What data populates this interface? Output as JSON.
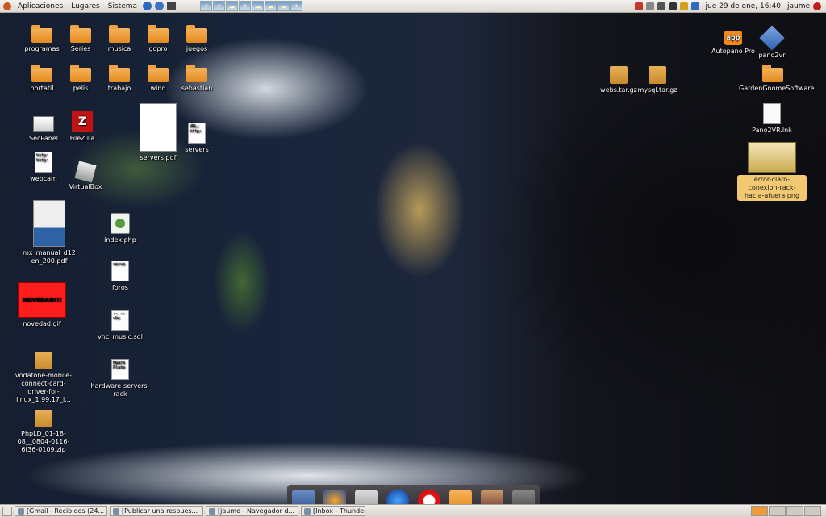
{
  "panel": {
    "menus": [
      "Aplicaciones",
      "Lugares",
      "Sistema"
    ],
    "clock": "jue 29 de ene, 16:40",
    "user": "jaume"
  },
  "desktop_icons": {
    "programas": "programas",
    "series": "Series",
    "musica": "musica",
    "gopro": "gopro",
    "juegos": "juegos",
    "portatil": "portatil",
    "pelis": "pelis",
    "trabajo": "trabajo",
    "wind": "wind",
    "sebastian": "sebastian",
    "secpanel": "SecPanel",
    "filezilla": "FileZilla",
    "servers_pdf": "servers.pdf",
    "servers": "servers",
    "webcam": "webcam",
    "virtualbox": "VirtualBox",
    "mx_manual": "mx_manual_d12 en_200.pdf",
    "index_php": "index.php",
    "foros": "foros",
    "novedad": "novedad.gif",
    "novedad_text": "NOVEDAD!!!",
    "vhc_music": "vhc_music.sql",
    "vodafone": "vodafone-mobile-connect-card-driver-for-linux_1.99.17_i...",
    "hardware": "hardware-servers-rack",
    "phpld": "PhpLD_01-18-08__0804-0116-6f36-0109.zip",
    "webs_tar": "webs.tar.gz",
    "mysql_tar": "mysql.tar.gz",
    "autopano": "Autopano Pro",
    "pano2vr": "pano2vr",
    "gardengnome": "GardenGnomeSoftware",
    "pano2vr_lnk": "Pano2VR.lnk",
    "error_png": "error-claro-conexion-rack-hacia-afuera.png",
    "doc_url": "URL: http:",
    "doc_http": "http: http:",
    "doc_serve": "serve",
    "doc_vhc": "-- -- vhc",
    "doc_hware": "Hware Plate"
  },
  "dock_items": [
    "download-manager",
    "thunderbird",
    "file-cabinet",
    "firefox",
    "opera",
    "folder",
    "image-viewer",
    "trash"
  ],
  "dock_label": "[Inbox - Thunderbird]",
  "taskbar": {
    "tasks": [
      "[Gmail - Recibidos (24...",
      "[Publicar una respues...",
      "[jaume - Navegador d...",
      "[Inbox - Thunderbird]"
    ]
  },
  "colors": {
    "accent": "#f29b36",
    "folder": "#e48a1e",
    "selection": "#f2c970"
  }
}
